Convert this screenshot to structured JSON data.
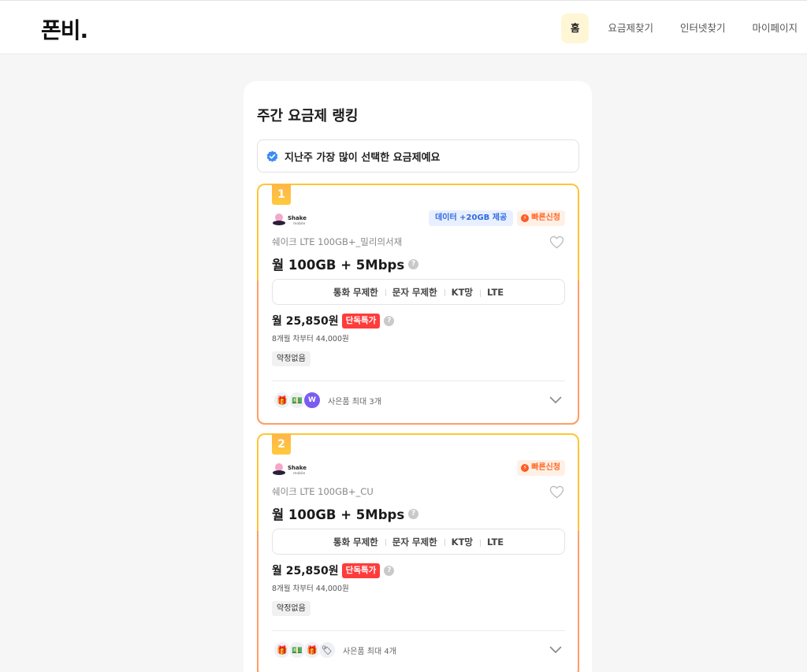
{
  "header": {
    "logo": "폰비.",
    "nav": [
      {
        "label": "홈",
        "active": true
      },
      {
        "label": "요금제찾기",
        "active": false
      },
      {
        "label": "인터넷찾기",
        "active": false
      },
      {
        "label": "마이페이지",
        "active": false
      }
    ]
  },
  "panel": {
    "title": "주간 요금제 랭킹",
    "notice": "지난주 가장 많이 선택한 요금제예요"
  },
  "cards": [
    {
      "rank": "1",
      "brand_icon": "shake-mobile-logo",
      "badge_data": "데이터 +20GB 제공",
      "badge_fast": "빠른신청",
      "plan_name": "쉐이크 LTE 100GB+_밀리의서재",
      "plan_main": "월 100GB + 5Mbps",
      "features": [
        "통화 무제한",
        "문자 무제한",
        "KT망",
        "LTE"
      ],
      "price": "월 25,850원",
      "exclusive": "단독특가",
      "after_price": "8개월 차부터 44,000원",
      "contract": "약정없음",
      "gift_text": "사은품 최대 3개",
      "gift_icons": [
        "gift-box-icon",
        "cash-icon",
        "wave-badge-icon"
      ]
    },
    {
      "rank": "2",
      "brand_icon": "shake-mobile-logo",
      "badge_fast": "빠른신청",
      "plan_name": "쉐이크 LTE 100GB+_CU",
      "plan_main": "월 100GB + 5Mbps",
      "features": [
        "통화 무제한",
        "문자 무제한",
        "KT망",
        "LTE"
      ],
      "price": "월 25,850원",
      "exclusive": "단독특가",
      "after_price": "8개월 차부터 44,000원",
      "contract": "약정없음",
      "gift_text": "사은품 최대 4개",
      "gift_icons": [
        "gift-box-icon",
        "cash-icon",
        "gift-box-icon",
        "tag-icon"
      ]
    }
  ],
  "colors": {
    "accent_yellow": "#ffc533",
    "accent_orange": "#ff9d66",
    "exclusive_red": "#ff3b3b",
    "data_badge_blue": "#2f6bdf"
  }
}
